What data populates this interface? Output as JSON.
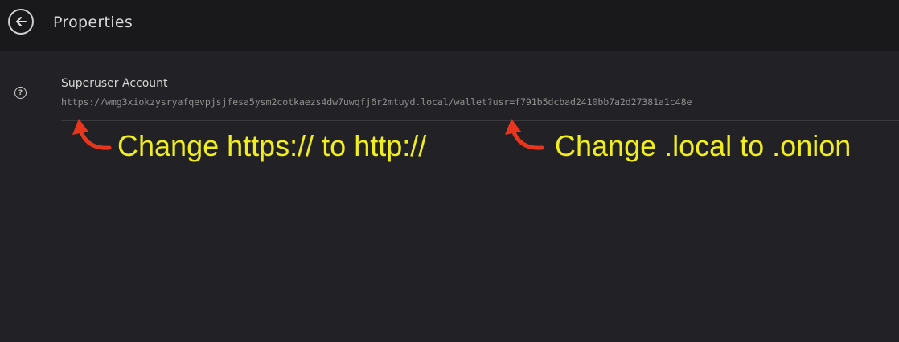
{
  "header": {
    "title": "Properties",
    "back_icon": "arrow-left-icon"
  },
  "item": {
    "icon": "help-circle-icon",
    "icon_glyph": "?",
    "title": "Superuser Account",
    "url": "https://wmg3xiokzysryafqevpjsjfesa5ysm2cotkaezs4dw7uwqfj6r2mtuyd.local/wallet?usr=f791b5dcbad2410bb7a2d27381a1c48e"
  },
  "annotations": {
    "first": "Change https:// to http://",
    "second": "Change .local to .onion",
    "text_color": "#f0ee1e",
    "arrow_color": "#e8361e"
  }
}
